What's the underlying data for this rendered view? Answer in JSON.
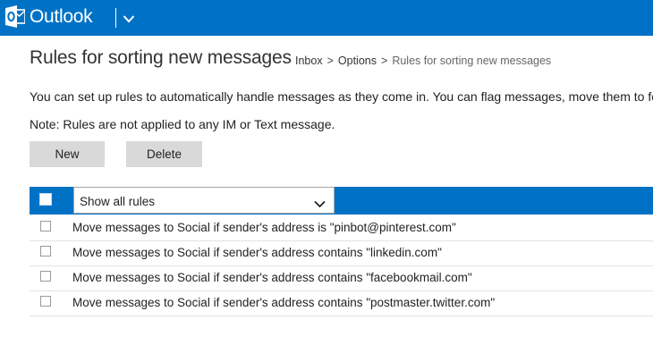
{
  "app": {
    "brand": "Outlook",
    "accent_color": "#0072c6",
    "logo_icon": "outlook-logo-icon",
    "menu_icon": "chevron-down-icon"
  },
  "page": {
    "title": "Rules for sorting new messages",
    "breadcrumb": [
      "Inbox",
      "Options",
      "Rules for sorting new messages"
    ],
    "breadcrumb_separator": ">",
    "description": "You can set up rules to automatically handle messages as they come in. You can flag messages, move them to fo",
    "note": "Note: Rules are not applied to any IM or Text message."
  },
  "toolbar": {
    "new_label": "New",
    "delete_label": "Delete"
  },
  "table": {
    "filter_selected": "Show all rules",
    "rules": [
      "Move messages to Social if sender's address is \"pinbot@pinterest.com\"",
      "Move messages to Social if sender's address contains \"linkedin.com\"",
      "Move messages to Social if sender's address contains \"facebookmail.com\"",
      "Move messages to Social if sender's address contains \"postmaster.twitter.com\""
    ]
  }
}
